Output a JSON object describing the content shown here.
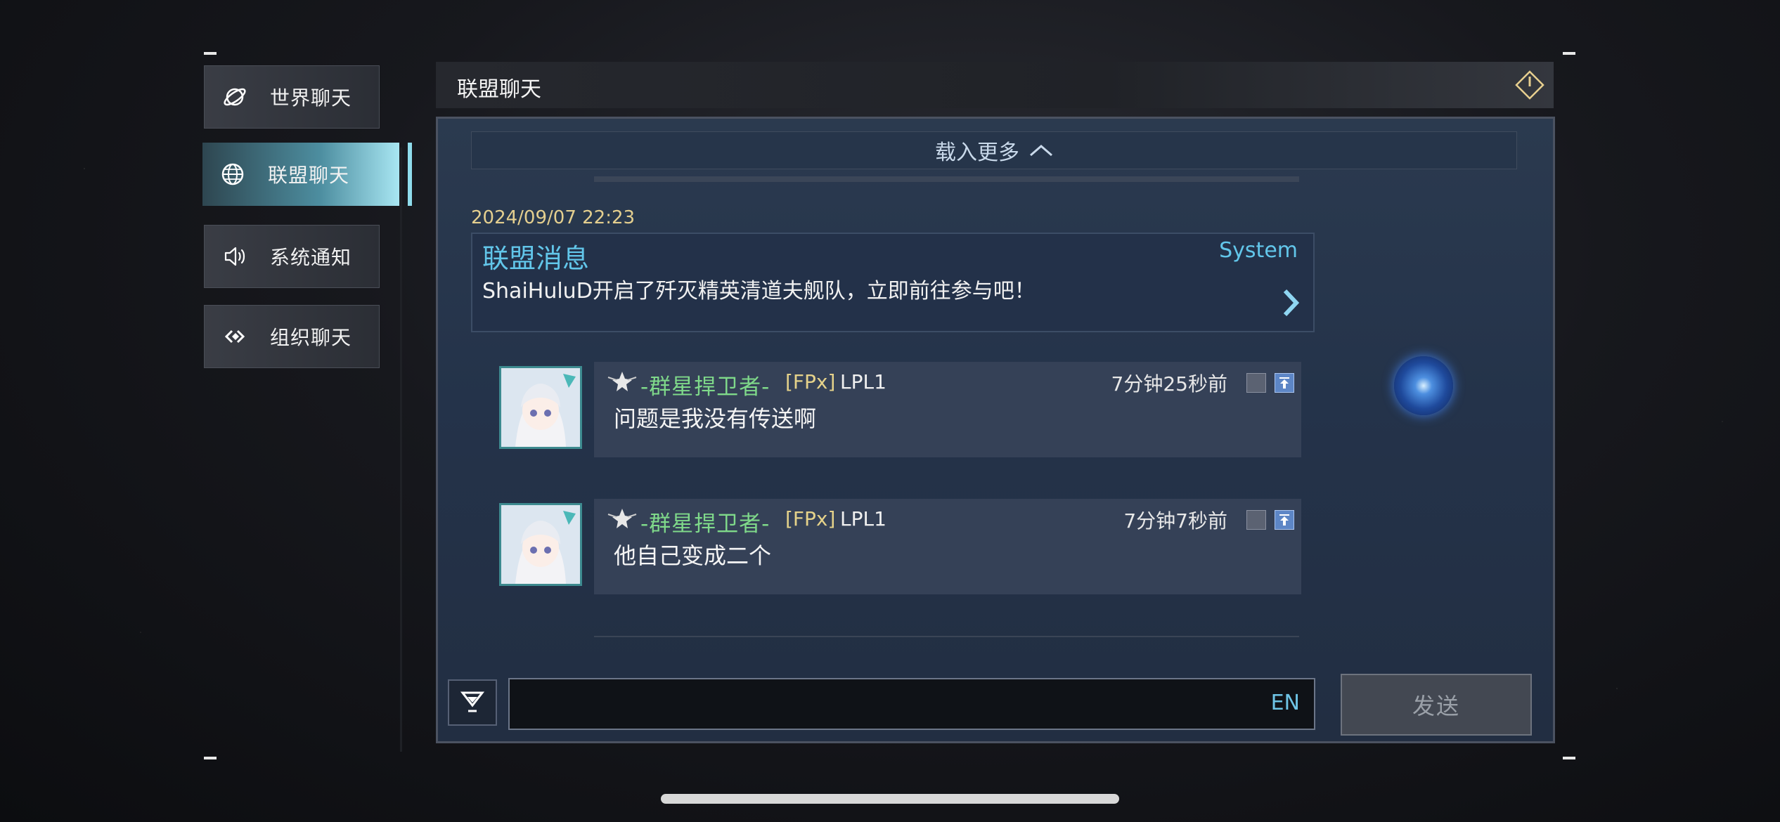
{
  "sidebar": {
    "items": [
      {
        "label": "世界聊天",
        "icon": "planet-icon"
      },
      {
        "label": "联盟聊天",
        "icon": "globe-icon",
        "active": true
      },
      {
        "label": "系统通知",
        "icon": "speaker-icon"
      },
      {
        "label": "组织聊天",
        "icon": "link-icon"
      }
    ]
  },
  "header": {
    "title": "联盟聊天",
    "close_icon": "diamond-exit-icon"
  },
  "chat": {
    "load_more": "载入更多",
    "system_message": {
      "timestamp": "2024/09/07 22:23",
      "title": "联盟消息",
      "source": "System",
      "text": "ShaiHuluD开启了歼灭精英清道夫舰队，立即前往参与吧！"
    },
    "messages": [
      {
        "name": "-群星捍卫者-",
        "org": "[FPx]",
        "level": "LPL1",
        "time": "7分钟25秒前",
        "text": "问题是我没有传送啊"
      },
      {
        "name": "-群星捍卫者-",
        "org": "[FPx]",
        "level": "LPL1",
        "time": "7分钟7秒前",
        "text": "他自己变成二个"
      }
    ]
  },
  "input": {
    "value": "",
    "lang": "EN",
    "send_label": "发送"
  },
  "colors": {
    "accent": "#62c6ea",
    "name_green": "#7fd98a",
    "gold": "#e4cf8f"
  }
}
